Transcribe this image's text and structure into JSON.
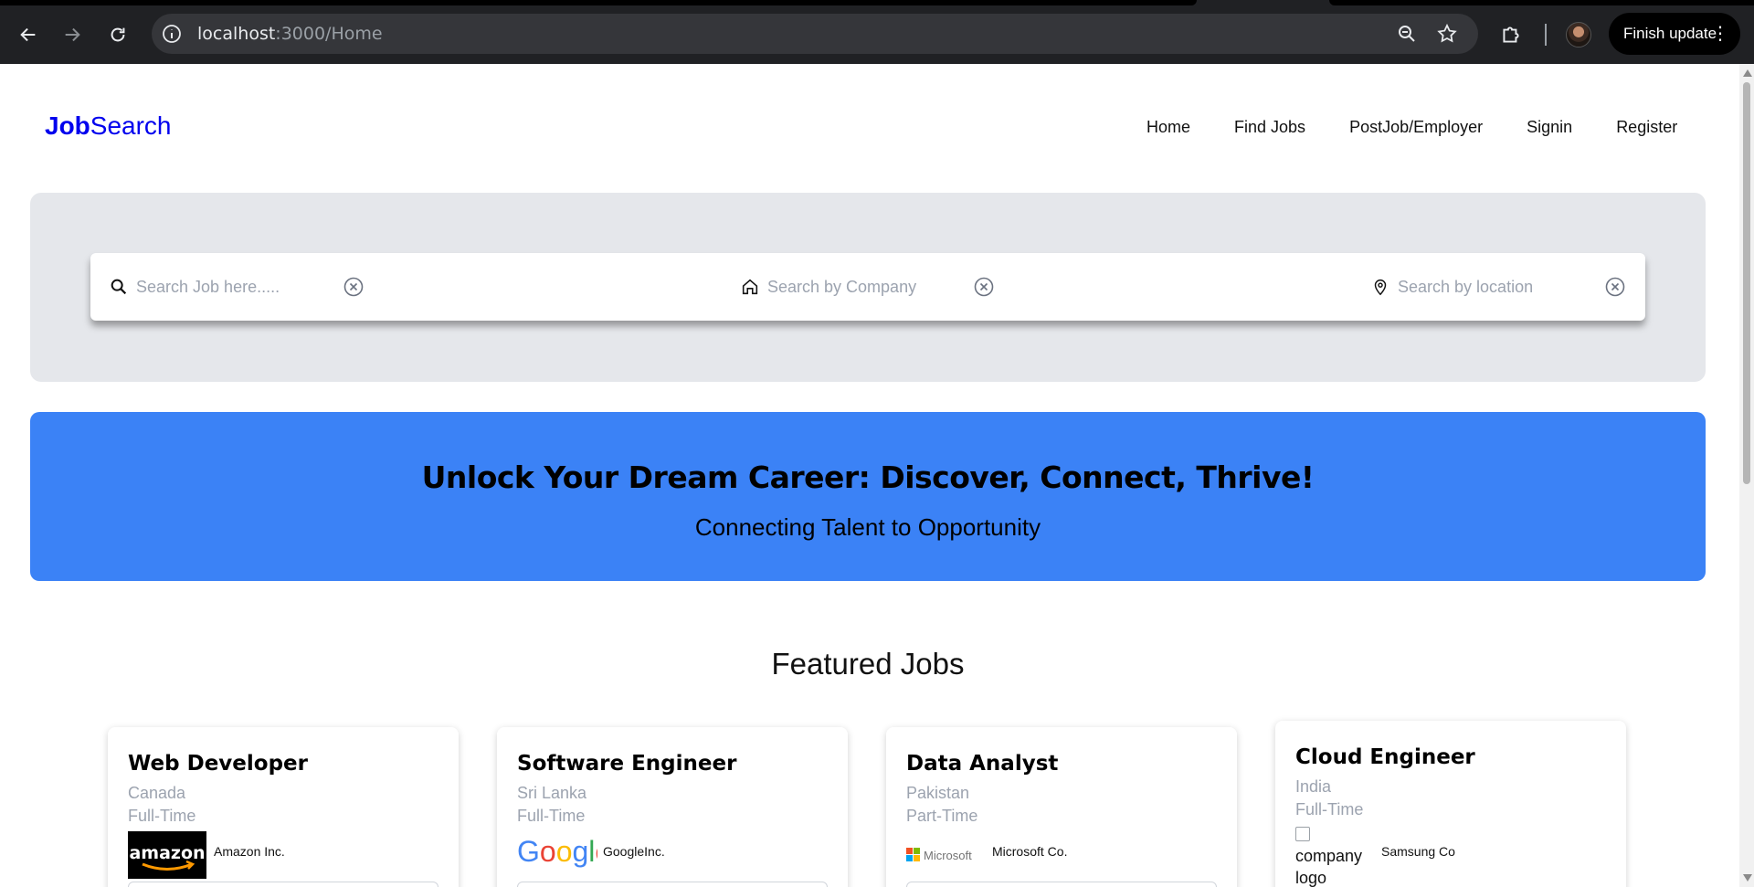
{
  "browser": {
    "url_host": "localhost",
    "url_path": ":3000/Home",
    "finish_update_label": "Finish update"
  },
  "site": {
    "logo_bold": "Job",
    "logo_rest": "Search",
    "nav": [
      "Home",
      "Find Jobs",
      "PostJob/Employer",
      "Signin",
      "Register"
    ]
  },
  "search": {
    "job_placeholder": "Search Job here.....",
    "company_placeholder": "Search by Company",
    "location_placeholder": "Search by location"
  },
  "hero": {
    "headline": "Unlock Your Dream Career: Discover, Connect, Thrive!",
    "subheadline": "Connecting Talent to Opportunity"
  },
  "featured": {
    "heading": "Featured Jobs",
    "jobs": [
      {
        "title": "Web Developer",
        "location": "Canada",
        "type": "Full-Time",
        "company": "Amazon Inc.",
        "logo": "amazon-logo"
      },
      {
        "title": "Software Engineer",
        "location": "Sri Lanka",
        "type": "Full-Time",
        "company": "GoogleInc.",
        "logo": "google-logo"
      },
      {
        "title": "Data Analyst",
        "location": "Pakistan",
        "type": "Part-Time",
        "company": "Microsoft Co.",
        "logo": "microsoft-logo"
      },
      {
        "title": "Cloud Engineer",
        "location": "India",
        "type": "Full-Time",
        "company": "Samsung Co",
        "logo": "broken-image",
        "logo_alt": "company logo"
      }
    ]
  },
  "colors": {
    "brand": "#0000ee",
    "hero_bg": "#3b82f6",
    "panel_bg": "#e5e7eb",
    "muted_text": "#9ca3af"
  }
}
